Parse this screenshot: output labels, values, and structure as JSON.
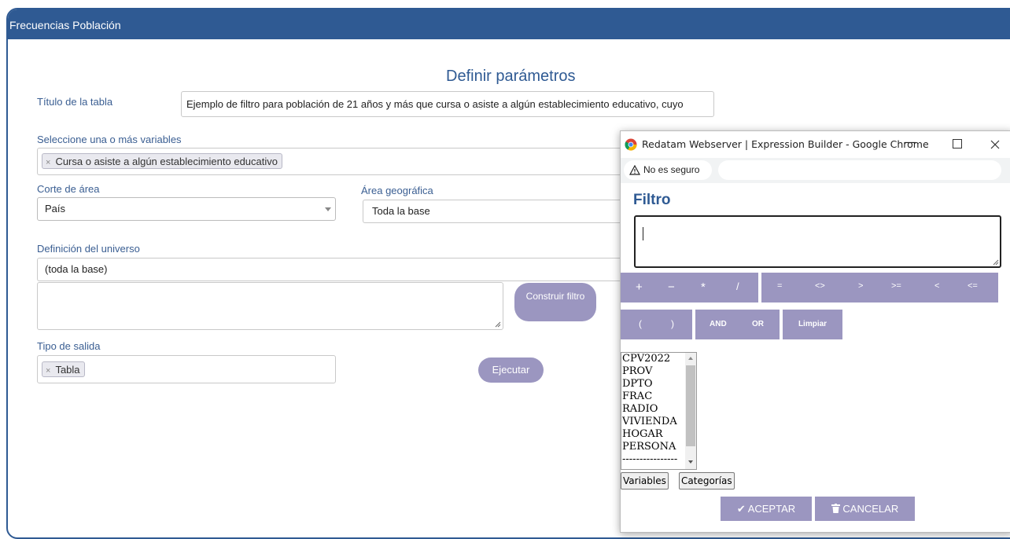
{
  "window": {
    "title": "Frecuencias Población"
  },
  "main": {
    "heading": "Definir parámetros",
    "titulo_label": "Título de la tabla",
    "titulo_value": "Ejemplo de filtro para población de 21 años y más que cursa o asiste a algún establecimiento educativo, cuyo",
    "variables_label": "Seleccione una o más variables",
    "variable_tag": "Cursa o asiste a algún establecimiento educativo",
    "corte_label": "Corte de área",
    "corte_value": "País",
    "area_label": "Área geográfica",
    "area_value": "Toda la base",
    "universo_label": "Definición del universo",
    "universo_value": "(toda la base)",
    "construir_label": "Construir filtro",
    "salida_label": "Tipo de salida",
    "salida_tag": "Tabla",
    "ejecutar_label": "Ejecutar",
    "tag_remove": "×"
  },
  "popup": {
    "window_title": "Redatam Webserver | Expression Builder - Google Chrome",
    "security_label": "No es seguro",
    "heading": "Filtro",
    "operators_row1": [
      "+",
      "−",
      "*",
      "/"
    ],
    "operators_row2": [
      "=",
      "<>",
      ">",
      ">=",
      "<",
      "<="
    ],
    "paren_open": "(",
    "paren_close": ")",
    "and_label": "AND",
    "or_label": "OR",
    "clear_label": "Limpiar",
    "list_items": [
      "CPV2022",
      "PROV",
      "DPTO",
      "FRAC",
      "RADIO",
      "VIVIENDA",
      "HOGAR",
      "PERSONA",
      "----------------"
    ],
    "variables_button": "Variables",
    "categorias_button": "Categorías",
    "accept_label": "ACEPTAR",
    "cancel_label": "CANCELAR"
  },
  "colors": {
    "header": "#2f5a93",
    "button": "#9b96c0",
    "label": "#3a5e92"
  }
}
